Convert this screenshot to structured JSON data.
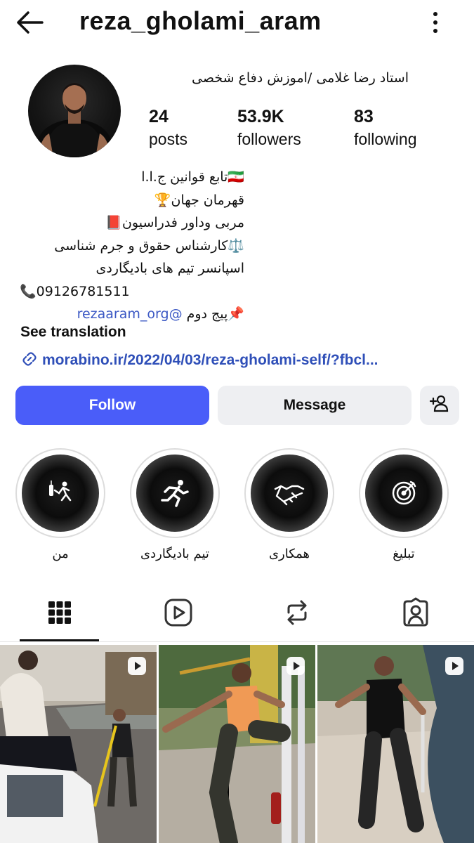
{
  "header": {
    "username": "reza_gholami_aram",
    "back_icon": "back-arrow-icon",
    "more_icon": "more-vertical-icon"
  },
  "profile": {
    "display_name": "استاد رضا غلامی  /اموزش دفاع شخصی",
    "stats": {
      "posts": {
        "value": "24",
        "label": "posts"
      },
      "followers": {
        "value": "53.9K",
        "label": "followers"
      },
      "following": {
        "value": "83",
        "label": "following"
      }
    },
    "bio_lines": [
      "🇮🇷تابع قوانین ج.ا.ا",
      "قهرمان جهان🏆",
      "مربی وداور فدراسیون📕",
      "⚖️کارشناس حقوق و جرم شناسی",
      "اسپانسر تیم های بادیگاردی",
      "📞09126781511"
    ],
    "bio_last": {
      "prefix": "📌پیج دوم ",
      "mention": "@rezaaram_org"
    },
    "see_translation": "See translation",
    "link": "morabino.ir/2022/04/03/reza-gholami-self/?fbcl..."
  },
  "actions": {
    "follow": "Follow",
    "message": "Message",
    "add_person_icon": "add-person-icon"
  },
  "highlights": [
    {
      "label": "من",
      "icon": "boxing-icon"
    },
    {
      "label": "تیم بادیگاردی",
      "icon": "runner-icon"
    },
    {
      "label": "همکاری",
      "icon": "handshake-icon"
    },
    {
      "label": "تبلیغ",
      "icon": "target-icon"
    }
  ],
  "tabs": [
    {
      "name": "posts-grid",
      "icon": "grid-icon",
      "active": true
    },
    {
      "name": "reels",
      "icon": "reels-icon",
      "active": false
    },
    {
      "name": "reposts",
      "icon": "repost-icon",
      "active": false
    },
    {
      "name": "tagged",
      "icon": "tagged-person-icon",
      "active": false
    }
  ],
  "grid": [
    {
      "type": "reel",
      "icon": "reel-play-icon"
    },
    {
      "type": "reel",
      "icon": "reel-play-icon"
    },
    {
      "type": "reel",
      "icon": "reel-play-icon"
    }
  ],
  "colors": {
    "follow_bg": "#4a5df9",
    "secondary_bg": "#eeeff2",
    "link": "#2f4fb8",
    "mention": "#3b58c4"
  }
}
